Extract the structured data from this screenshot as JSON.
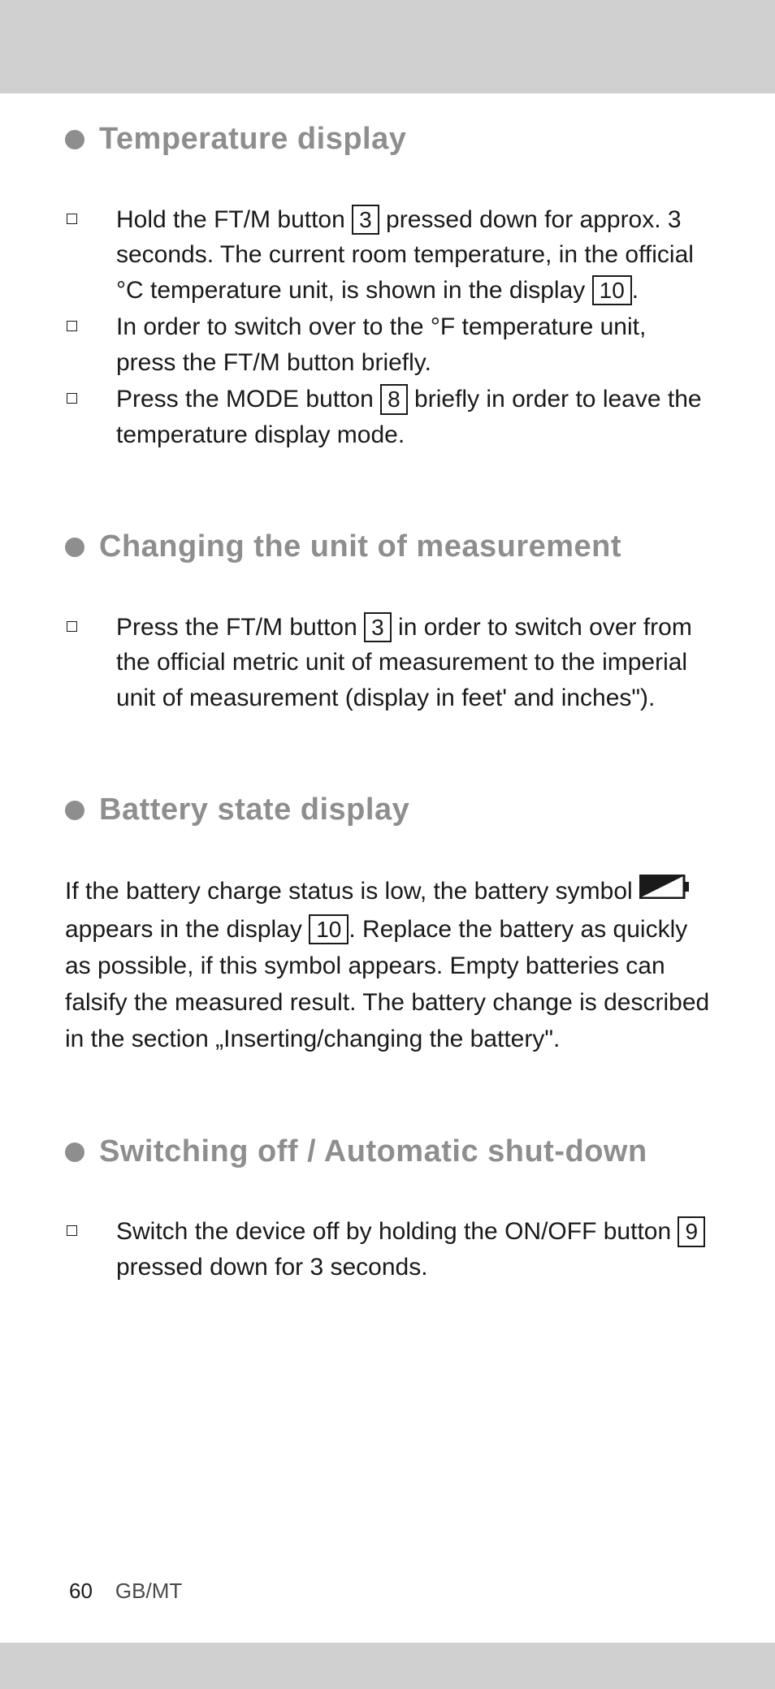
{
  "sections": [
    {
      "title": "Temperature display",
      "steps": [
        {
          "parts": [
            {
              "t": "text",
              "v": "Hold the FT/M button "
            },
            {
              "t": "key",
              "v": "3"
            },
            {
              "t": "text",
              "v": " pressed down for approx. 3 seconds. The current room temperature, in the official °C temperature unit, is shown in the display "
            },
            {
              "t": "key",
              "v": "10"
            },
            {
              "t": "text",
              "v": "."
            }
          ]
        },
        {
          "parts": [
            {
              "t": "text",
              "v": "In order to switch over to the °F temperature unit, press the FT/M button briefly."
            }
          ]
        },
        {
          "parts": [
            {
              "t": "text",
              "v": "Press the MODE button "
            },
            {
              "t": "key",
              "v": "8"
            },
            {
              "t": "text",
              "v": " briefly in order to leave the temperature display mode."
            }
          ]
        }
      ]
    },
    {
      "title": "Changing the unit of measurement",
      "steps": [
        {
          "parts": [
            {
              "t": "text",
              "v": "Press the FT/M button "
            },
            {
              "t": "key",
              "v": "3"
            },
            {
              "t": "text",
              "v": " in order to switch over from the official metric unit of measurement to the imperial unit of measurement (display in feet' and inches\")."
            }
          ]
        }
      ]
    },
    {
      "title": "Battery state display",
      "paragraph": [
        {
          "t": "text",
          "v": "If the battery charge status is low, the battery symbol "
        },
        {
          "t": "battery"
        },
        {
          "t": "text",
          "v": " appears in the display "
        },
        {
          "t": "key",
          "v": "10"
        },
        {
          "t": "text",
          "v": ". Replace the battery as quickly as possible, if this symbol appears. Empty batteries can falsify the measured result. The battery change is described in the section „Inserting/changing the battery\"."
        }
      ]
    },
    {
      "title": "Switching off / Automatic shut-down",
      "steps": [
        {
          "parts": [
            {
              "t": "text",
              "v": "Switch the device off by holding the ON/OFF button "
            },
            {
              "t": "key",
              "v": "9"
            },
            {
              "t": "text",
              "v": " pressed down for 3 seconds."
            }
          ]
        }
      ]
    }
  ],
  "footer": {
    "page": "60",
    "locale": "GB/MT"
  }
}
